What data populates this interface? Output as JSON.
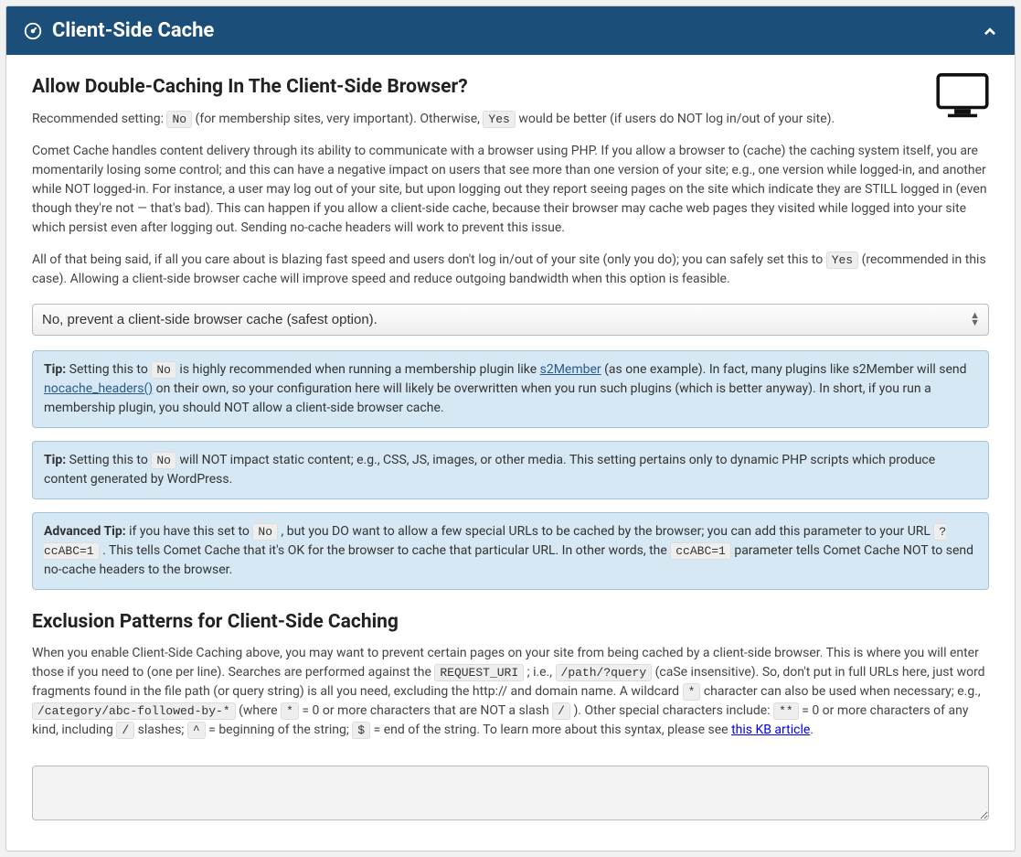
{
  "header": {
    "title": "Client-Side Cache"
  },
  "section1": {
    "heading": "Allow Double-Caching In The Client-Side Browser?",
    "rec_prefix": "Recommended setting: ",
    "rec_val": "No",
    "rec_mid": " (for membership sites, very important). Otherwise, ",
    "rec_val2": "Yes",
    "rec_suffix": " would be better (if users do NOT log in/out of your site).",
    "para1": "Comet Cache handles content delivery through its ability to communicate with a browser using PHP. If you allow a browser to (cache) the caching system itself, you are momentarily losing some control; and this can have a negative impact on users that see more than one version of your site; e.g., one version while logged-in, and another while NOT logged-in. For instance, a user may log out of your site, but upon logging out they report seeing pages on the site which indicate they are STILL logged in (even though they're not — that's bad). This can happen if you allow a client-side cache, because their browser may cache web pages they visited while logged into your site which persist even after logging out. Sending no-cache headers will work to prevent this issue.",
    "para2_pre": "All of that being said, if all you care about is blazing fast speed and users don't log in/out of your site (only you do); you can safely set this to ",
    "para2_code": "Yes",
    "para2_post": " (recommended in this case). Allowing a client-side browser cache will improve speed and reduce outgoing bandwidth when this option is feasible.",
    "select_value": "No, prevent a client-side browser cache (safest option)."
  },
  "tip1": {
    "label": "Tip:",
    "t1": " Setting this to ",
    "c1": "No",
    "t2": " is highly recommended when running a membership plugin like ",
    "link1": "s2Member",
    "t3": " (as one example). In fact, many plugins like s2Member will send ",
    "link2": "nocache_headers()",
    "t4": " on their own, so your configuration here will likely be overwritten when you run such plugins (which is better anyway). In short, if you run a membership plugin, you should NOT allow a client-side browser cache."
  },
  "tip2": {
    "label": "Tip:",
    "t1": " Setting this to ",
    "c1": "No",
    "t2": " will NOT impact static content; e.g., CSS, JS, images, or other media. This setting pertains only to dynamic PHP scripts which produce content generated by WordPress."
  },
  "tip3": {
    "label": "Advanced Tip:",
    "t1": " if you have this set to ",
    "c1": "No",
    "t2": " , but you DO want to allow a few special URLs to be cached by the browser; you can add this parameter to your URL ",
    "c2": "?ccABC=1",
    "t3": " . This tells Comet Cache that it's OK for the browser to cache that particular URL. In other words, the ",
    "c3": "ccABC=1",
    "t4": " parameter tells Comet Cache NOT to send no-cache headers to the browser."
  },
  "section2": {
    "heading": "Exclusion Patterns for Client-Side Caching",
    "p_t1": "When you enable Client-Side Caching above, you may want to prevent certain pages on your site from being cached by a client-side browser. This is where you will enter those if you need to (one per line). Searches are performed against the ",
    "c1": "REQUEST_URI",
    "p_t2": " ; i.e., ",
    "c2": "/path/?query",
    "p_t3": " (caSe insensitive). So, don't put in full URLs here, just word fragments found in the file path (or query string) is all you need, excluding the http:// and domain name. A wildcard ",
    "c3": "*",
    "p_t4": " character can also be used when necessary; e.g., ",
    "c4": "/category/abc-followed-by-*",
    "p_t5": " (where ",
    "c5": "*",
    "p_t6": " = 0 or more characters that are NOT a slash ",
    "c6": "/",
    "p_t7": " ). Other special characters include: ",
    "c7": "**",
    "p_t8": " = 0 or more characters of any kind, including ",
    "c8": "/",
    "p_t9": " slashes; ",
    "c9": "^",
    "p_t10": " = beginning of the string; ",
    "c10": "$",
    "p_t11": " = end of the string. To learn more about this syntax, please see ",
    "link": "this KB article",
    "p_t12": ".",
    "textarea_value": ""
  }
}
